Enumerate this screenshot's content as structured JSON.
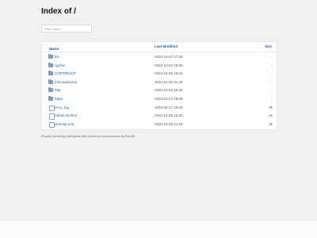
{
  "page": {
    "title": "Index of /"
  },
  "filter": {
    "placeholder": "Filter Name"
  },
  "table": {
    "headers": {
      "name": "Name",
      "sort_arrow": "↑",
      "modified": "Last Modified",
      "size": "Size"
    },
    "rows": [
      {
        "name": "bin",
        "type": "folder",
        "modified": "2022-10-27 17:35",
        "size": "-"
      },
      {
        "name": "cgi-bin",
        "type": "folder",
        "modified": "2022-10-04 19:30",
        "size": "-"
      },
      {
        "name": "COPYRIGHT",
        "type": "folder",
        "modified": "2022-10-30 18:24",
        "size": "-"
      },
      {
        "name": "font-awesome",
        "type": "folder",
        "modified": "2022-10-25 21:49",
        "size": "-"
      },
      {
        "name": "http",
        "type": "folder",
        "modified": "2022-10-04 18:32",
        "size": "-"
      },
      {
        "name": "https",
        "type": "folder",
        "modified": "2022-10-24 19:09",
        "size": "-"
      },
      {
        "name": "error_log",
        "type": "file",
        "modified": "2023-02-17 19:34",
        "size": "8k"
      },
      {
        "name": "robots.txt.bksl",
        "type": "file",
        "modified": "2022-10-25 16:30",
        "size": "4k"
      },
      {
        "name": "sitemap.xml",
        "type": "file",
        "modified": "2022-10-25 21:53",
        "size": "4k"
      }
    ]
  },
  "footer": {
    "text": "Proudly Served by LiteSpeed Web Server at incomessence.bs Port 80"
  }
}
